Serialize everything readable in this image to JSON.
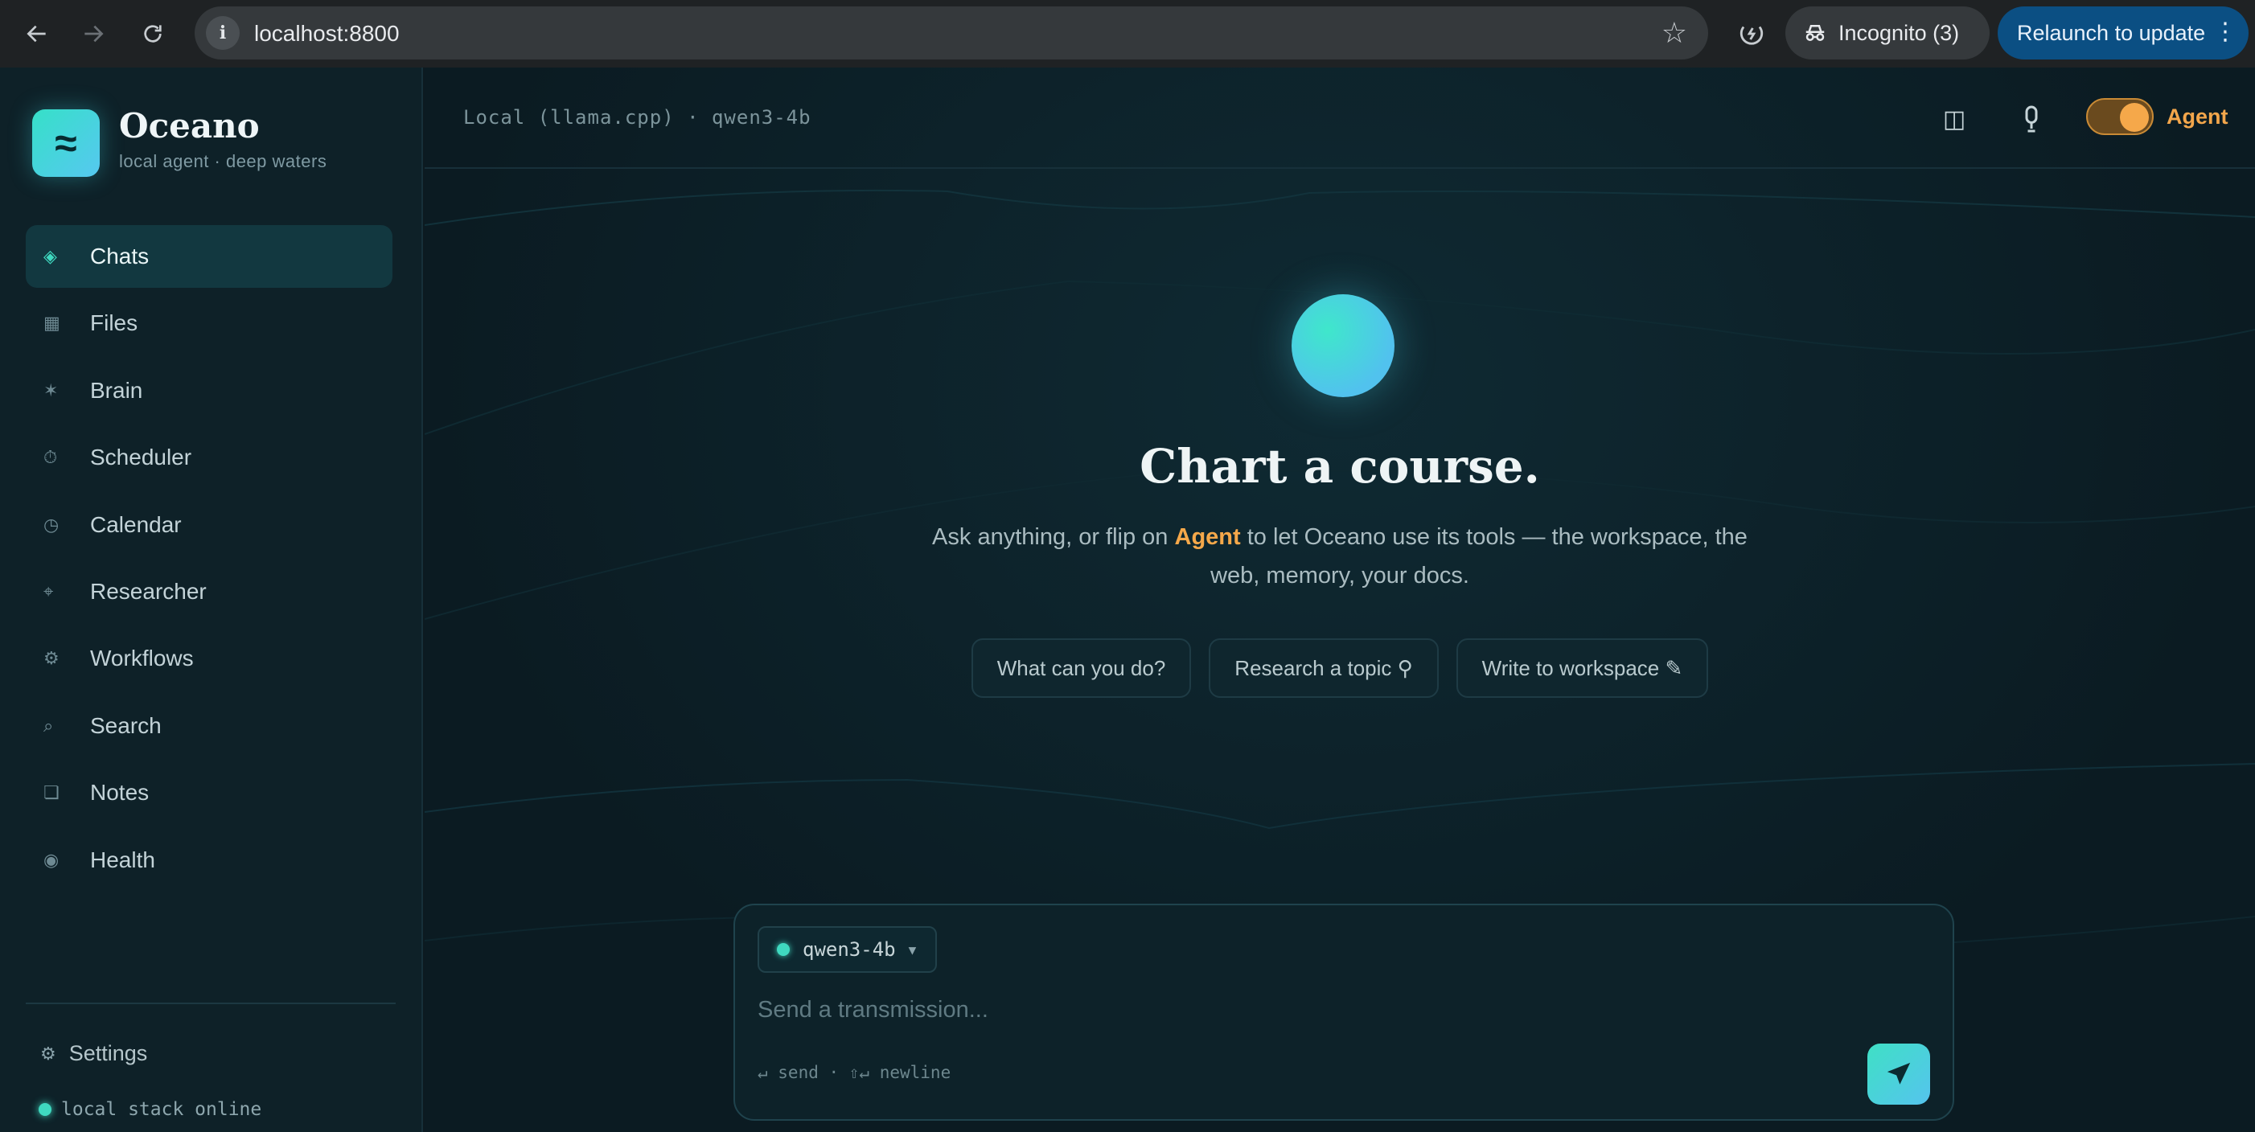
{
  "browser": {
    "url": "localhost:8800",
    "incognito_label": "Incognito (3)",
    "relaunch_label": "Relaunch to update",
    "back_icon": "arrow-left-icon",
    "forward_icon": "arrow-right-icon",
    "reload_icon": "reload-icon",
    "info_icon": "info-icon",
    "bookmark_icon": "star-icon"
  },
  "sidebar": {
    "logo_glyph": "≈",
    "brand": "Oceano",
    "tagline": "local agent · deep waters",
    "items": [
      {
        "label": "Chats",
        "icon": "diamond-icon",
        "glyph": "◈",
        "active": true
      },
      {
        "label": "Files",
        "icon": "square-icon",
        "glyph": "▦",
        "active": false
      },
      {
        "label": "Brain",
        "icon": "asterisk-icon",
        "glyph": "✶",
        "active": false
      },
      {
        "label": "Scheduler",
        "icon": "timer-icon",
        "glyph": "⏱",
        "active": false
      },
      {
        "label": "Calendar",
        "icon": "clock-icon",
        "glyph": "◷",
        "active": false
      },
      {
        "label": "Researcher",
        "icon": "crosshair-icon",
        "glyph": "⌖",
        "active": false
      },
      {
        "label": "Workflows",
        "icon": "gear-icon",
        "glyph": "⚙",
        "active": false
      },
      {
        "label": "Search",
        "icon": "search-icon",
        "glyph": "⌕",
        "active": false
      },
      {
        "label": "Notes",
        "icon": "note-icon",
        "glyph": "❏",
        "active": false
      },
      {
        "label": "Health",
        "icon": "pulse-icon",
        "glyph": "◉",
        "active": false
      }
    ],
    "settings_label": "Settings",
    "settings_glyph": "⚙",
    "status_text": "local stack online"
  },
  "topbar": {
    "provider": "Local (llama.cpp) · qwen3-4b",
    "agent_label": "Agent",
    "agent_enabled": true
  },
  "hero": {
    "title": "Chart a course.",
    "sub_before": "Ask anything, or flip on ",
    "sub_highlight": "Agent",
    "sub_after": " to let Oceano use its tools — the workspace, the web, memory, your docs.",
    "chips": [
      "What can you do?",
      "Research a topic ⚲",
      "Write to workspace ✎"
    ]
  },
  "composer": {
    "model": "qwen3-4b",
    "placeholder": "Send a transmission...",
    "hint": "↵ send · ⇧↵ newline"
  },
  "colors": {
    "accent": "#3fd9c0",
    "agent": "#f5a84a",
    "background": "#0c1a20"
  }
}
